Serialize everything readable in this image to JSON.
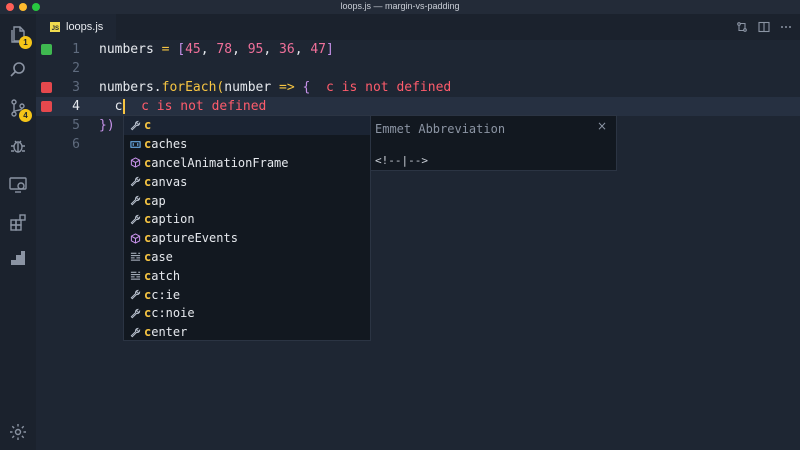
{
  "window": {
    "title": "loops.js — margin-vs-padding"
  },
  "activity_bar": {
    "items": [
      {
        "icon": "files-icon",
        "badge": "1"
      },
      {
        "icon": "search-icon"
      },
      {
        "icon": "source-control-icon",
        "badge": "4"
      },
      {
        "icon": "debug-icon"
      },
      {
        "icon": "remote-explorer-icon"
      },
      {
        "icon": "extensions-icon"
      },
      {
        "icon": "stairs-icon"
      },
      {
        "icon": "settings-gear-icon"
      }
    ]
  },
  "tabs": [
    {
      "label": "loops.js",
      "lang_badge": "JS"
    }
  ],
  "editor": {
    "lines": [
      {
        "number": "1"
      },
      {
        "number": "2"
      },
      {
        "number": "3",
        "error": "c is not defined"
      },
      {
        "number": "4",
        "typed": "c",
        "error": "c is not defined"
      },
      {
        "number": "5",
        "text": "})"
      },
      {
        "number": "6"
      }
    ],
    "line1": {
      "ident": "numbers",
      "eq": " = ",
      "open": "[",
      "n1": "45",
      "n2": "78",
      "n3": "95",
      "n4": "36",
      "n5": "47",
      "close": "]",
      "sep": ", "
    },
    "line3": {
      "ident": "numbers",
      "dot": ".",
      "method": "forEach",
      "paren": "(",
      "param": "number",
      "arrow": " => ",
      "brace": "{"
    }
  },
  "suggestions": {
    "typed_prefix": "c",
    "items": [
      {
        "highlight": "c",
        "rest": "",
        "icon": "wrench-icon"
      },
      {
        "highlight": "c",
        "rest": "aches",
        "icon": "variable-icon"
      },
      {
        "highlight": "c",
        "rest": "ancelAnimationFrame",
        "icon": "cube-icon"
      },
      {
        "highlight": "c",
        "rest": "anvas",
        "icon": "wrench-icon"
      },
      {
        "highlight": "c",
        "rest": "ap",
        "icon": "wrench-icon"
      },
      {
        "highlight": "c",
        "rest": "aption",
        "icon": "wrench-icon"
      },
      {
        "highlight": "c",
        "rest": "aptureEvents",
        "icon": "cube-icon"
      },
      {
        "highlight": "c",
        "rest": "ase",
        "icon": "keyword-icon"
      },
      {
        "highlight": "c",
        "rest": "atch",
        "icon": "keyword-icon"
      },
      {
        "highlight": "c",
        "rest": "c:ie",
        "icon": "wrench-icon"
      },
      {
        "highlight": "c",
        "rest": "c:noie",
        "icon": "wrench-icon"
      },
      {
        "highlight": "c",
        "rest": "enter",
        "icon": "wrench-icon"
      }
    ],
    "details": {
      "title": "Emmet Abbreviation",
      "body": "<!--|-->",
      "close": "×"
    }
  },
  "colors": {
    "accent": "#f7c542",
    "error": "#ff5c6c",
    "number": "#f0709a"
  }
}
